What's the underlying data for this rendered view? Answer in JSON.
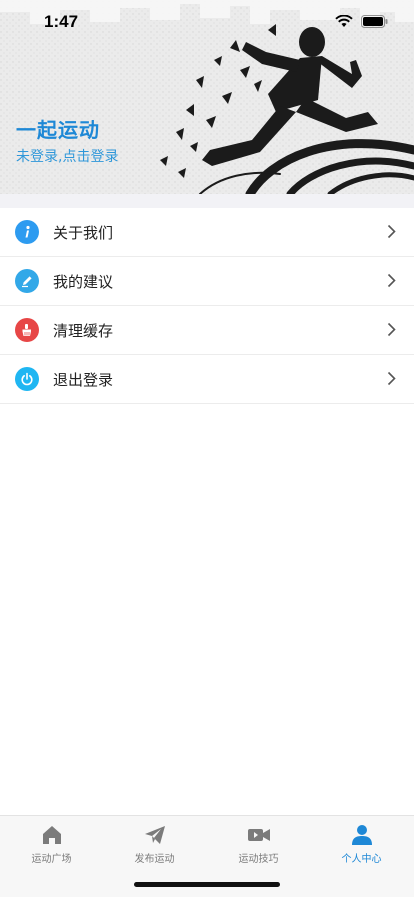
{
  "status": {
    "time": "1:47"
  },
  "header": {
    "app_title": "一起运动",
    "login_hint": "未登录,点击登录"
  },
  "menu": {
    "items": [
      {
        "label": "关于我们",
        "icon": "info-icon",
        "color": "#2d9bf0"
      },
      {
        "label": "我的建议",
        "icon": "edit-pencil-icon",
        "color": "#32a8e8"
      },
      {
        "label": "清理缓存",
        "icon": "broom-icon",
        "color": "#e74646"
      },
      {
        "label": "退出登录",
        "icon": "power-icon",
        "color": "#1fb6f2"
      }
    ]
  },
  "tabbar": {
    "tabs": [
      {
        "label": "运动广场",
        "icon": "home-icon",
        "active": false
      },
      {
        "label": "发布运动",
        "icon": "paper-plane-icon",
        "active": false
      },
      {
        "label": "运动技巧",
        "icon": "video-camera-icon",
        "active": false
      },
      {
        "label": "个人中心",
        "icon": "person-icon",
        "active": true
      }
    ],
    "active_color": "#1e88d6",
    "inactive_color": "#7b7b7b"
  }
}
